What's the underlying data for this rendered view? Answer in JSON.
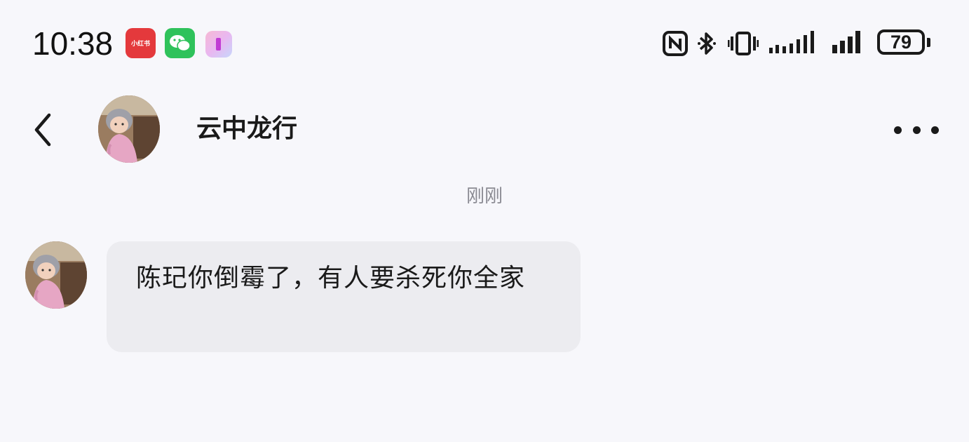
{
  "status_bar": {
    "time": "10:38",
    "notification_icons": [
      "xiaohongshu-icon",
      "wechat-icon",
      "app-icon"
    ],
    "xiaohongshu_label": "小红书",
    "system_icons": [
      "nfc-icon",
      "bluetooth-icon",
      "vibrate-icon",
      "signal-icon",
      "signal-icon"
    ],
    "battery_level": "79"
  },
  "header": {
    "contact_name": "云中龙行",
    "back_icon": "chevron-left-icon",
    "more_icon": "more-horizontal-icon"
  },
  "chat": {
    "timestamp": "刚刚",
    "messages": [
      {
        "sender": "contact",
        "text": "陈玘你倒霉了，有人要杀死你全家"
      }
    ]
  },
  "colors": {
    "background": "#f7f7fb",
    "bubble": "#ececf0",
    "timestamp_text": "#8a8a92",
    "xiaohongshu_red": "#e4393c",
    "wechat_green": "#2fc25b"
  }
}
